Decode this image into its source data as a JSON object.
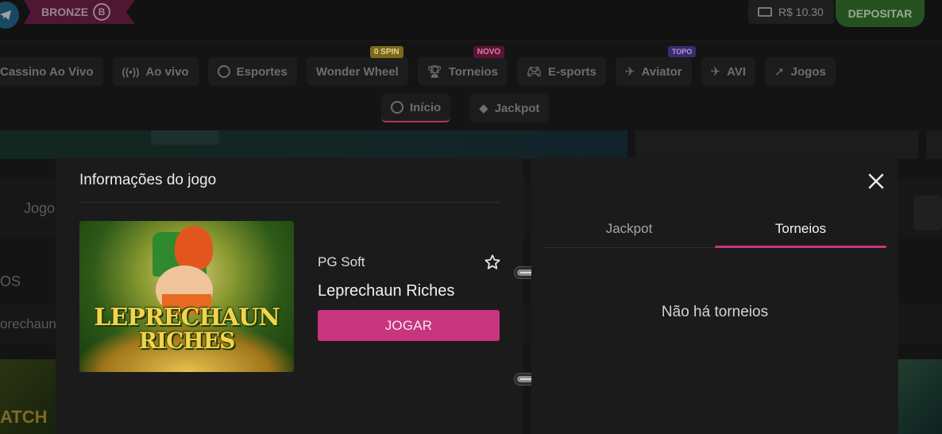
{
  "topbar": {
    "rank_label": "BRONZE",
    "rank_icon_letter": "B",
    "balance": "R$ 10.30",
    "deposit_label": "DEPOSITAR"
  },
  "nav": {
    "row1": [
      {
        "label": "Cassino Ao Vivo",
        "icon": "live-casino-icon"
      },
      {
        "label": "Ao vivo",
        "icon": "broadcast-icon"
      },
      {
        "label": "Esportes",
        "icon": "soccer-ball-icon"
      },
      {
        "label": "Wonder Wheel",
        "badge": "0 SPIN"
      },
      {
        "label": "Torneios",
        "icon": "trophy-icon",
        "badge": "NOVO"
      },
      {
        "label": "E-sports",
        "icon": "gamepad-icon"
      },
      {
        "label": "Aviator",
        "icon": "plane-icon",
        "badge": "TOPO"
      },
      {
        "label": "AVI",
        "icon": "plane-icon"
      },
      {
        "label": "Jogos",
        "icon": "rocket-icon"
      }
    ],
    "row2": [
      {
        "label": "Início",
        "icon": "home-icon"
      },
      {
        "label": "Jackpot",
        "icon": "diamond-icon"
      }
    ]
  },
  "background": {
    "text1": "Jogo",
    "text2": "OS",
    "text3": "orechaun",
    "thumb_text": "ATCH"
  },
  "modal": {
    "title": "Informações do jogo",
    "thumbnail_line1": "LEPRECHAUN",
    "thumbnail_line2": "RICHES",
    "provider": "PG Soft",
    "game_name": "Leprechaun Riches",
    "play_label": "JOGAR",
    "tabs": [
      {
        "label": "Jackpot"
      },
      {
        "label": "Torneios"
      }
    ],
    "empty_message": "Não há torneios"
  },
  "colors": {
    "accent": "#c8357f",
    "deposit": "#2f6e2a"
  }
}
